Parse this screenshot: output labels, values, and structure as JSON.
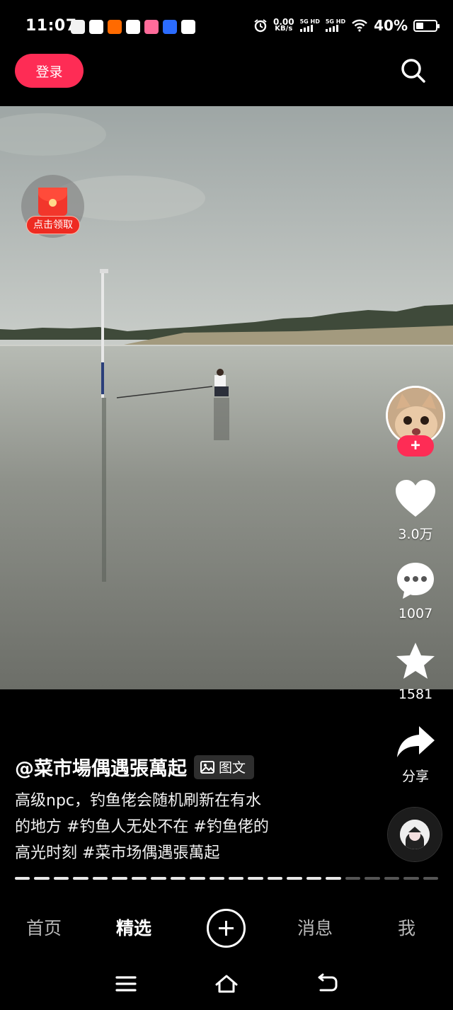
{
  "status_bar": {
    "time": "11:07",
    "net_speed_value": "0.00",
    "net_speed_unit": "KB/s",
    "sim1": "5G HD",
    "sim2": "5G HD",
    "battery_percent": "40%",
    "battery_level": 0.4,
    "app_icons": [
      "calendar-icon",
      "wechat-icon",
      "taobao-icon",
      "tiktok-icon",
      "app-icon",
      "bilibili-icon",
      "location-icon"
    ],
    "app_icon_colors": [
      "#f2f2f2",
      "#ffffff",
      "#ff6a00",
      "#ffffff",
      "#ff6b9a",
      "#2b6cff",
      "#ffffff"
    ]
  },
  "top_bar": {
    "login_label": "登录",
    "accent": "#fe2c55"
  },
  "red_packet": {
    "label": "点击领取"
  },
  "rail": {
    "likes": "3.0万",
    "comments": "1007",
    "favorites": "1581",
    "share_label": "分享"
  },
  "post": {
    "author": "@菜市場偶遇張萬起",
    "badge": "图文",
    "description_lines": [
      "高级npc，钓鱼佬会随机刷新在有水",
      "的地方 #钓鱼人无处不在 #钓鱼佬的",
      "高光时刻 #菜市场偶遇張萬起"
    ],
    "slides_total": 22,
    "slides_seen": 17
  },
  "bottom_nav": {
    "home": "首页",
    "featured": "精选",
    "messages": "消息",
    "me": "我"
  }
}
